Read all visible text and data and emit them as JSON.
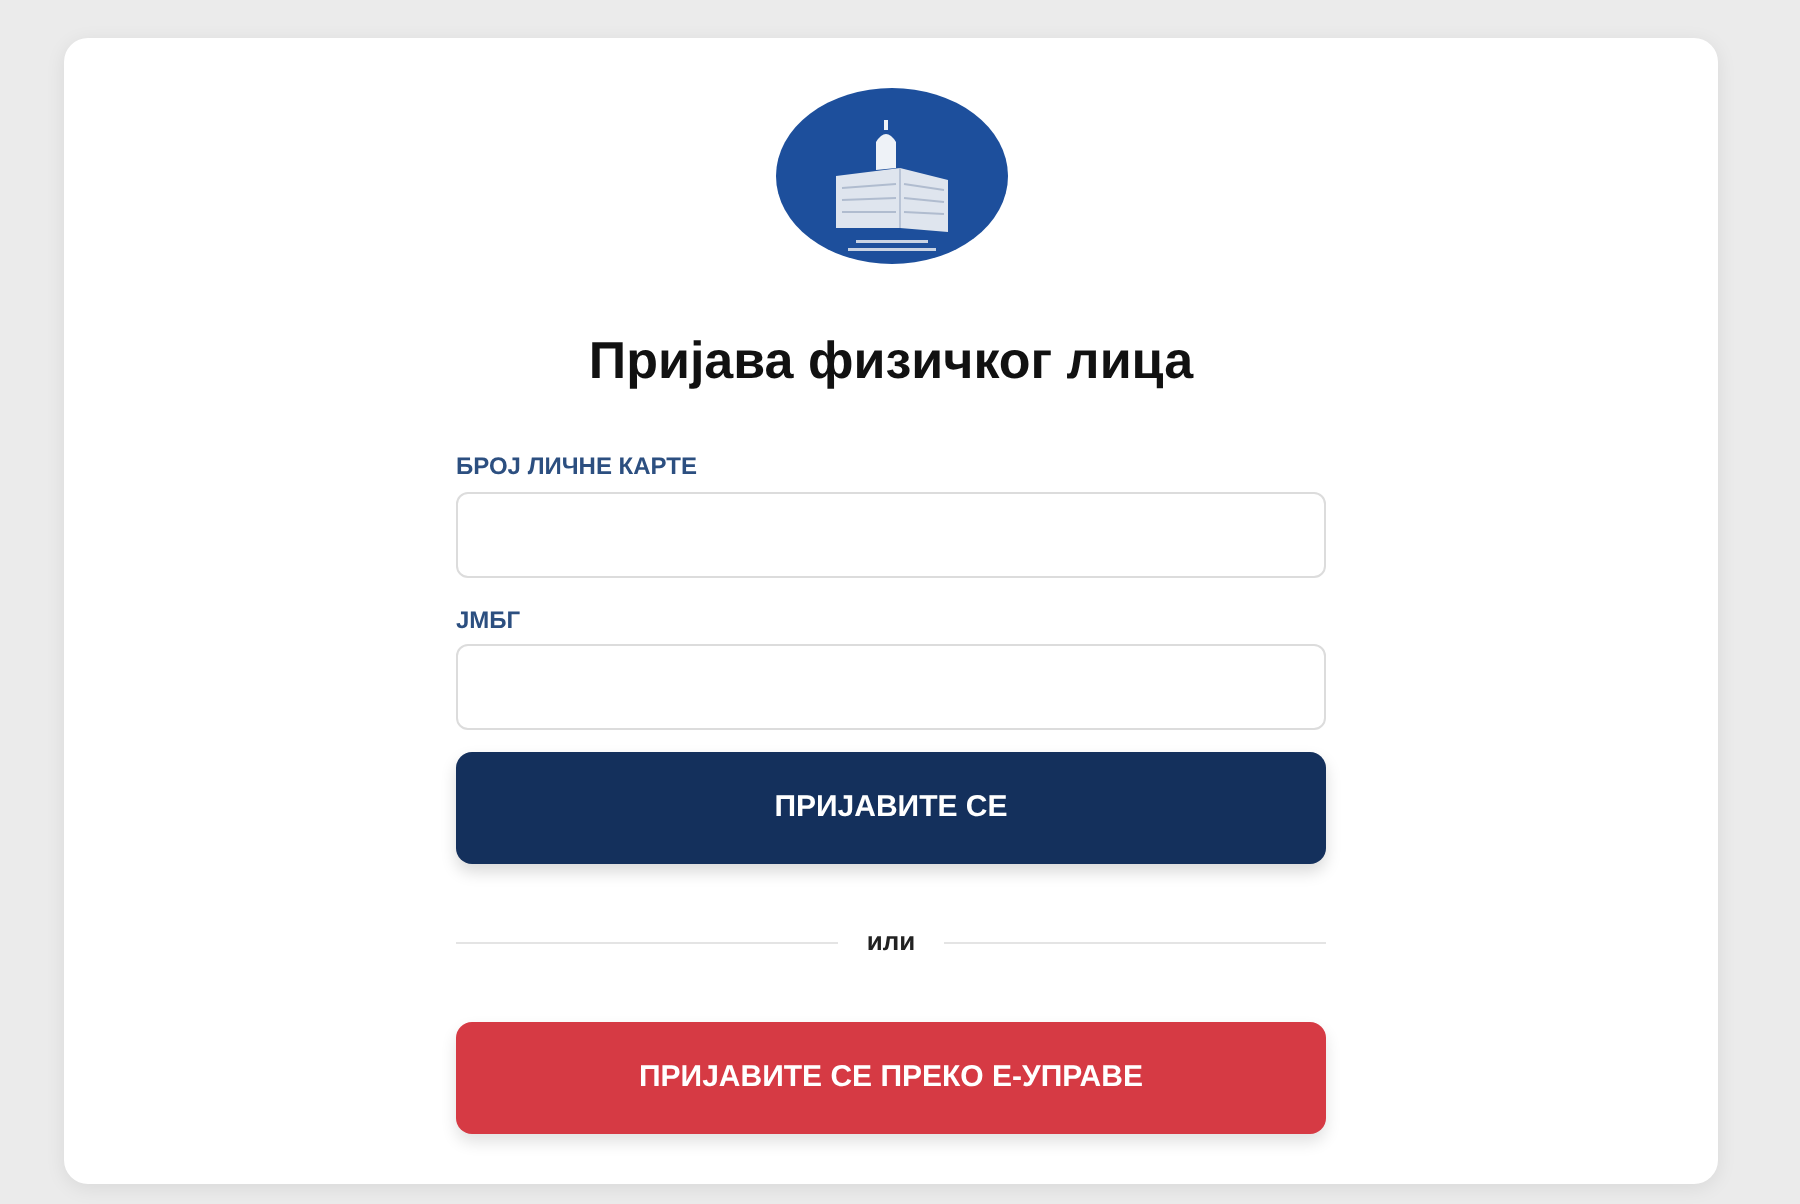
{
  "title": "Пријава физичког лица",
  "fields": [
    {
      "label": "БРОЈ ЛИЧНЕ КАРТЕ"
    },
    {
      "label": "ЈМБГ"
    }
  ],
  "primary_button": {
    "label": "ПРИЈАВИТЕ СЕ"
  },
  "divider": {
    "label": "или"
  },
  "egov_button": {
    "label": "ПРИЈАВИТЕ СЕ ПРЕКО Е-УПРАВЕ"
  }
}
